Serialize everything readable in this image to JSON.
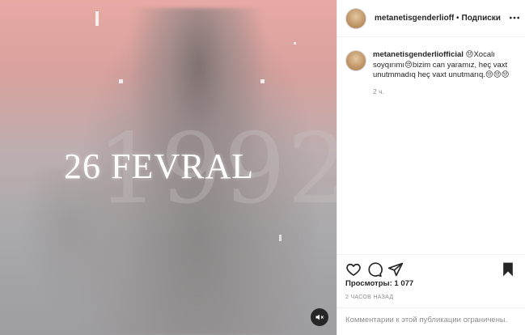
{
  "post": {
    "headline": "26 FEVRAL",
    "ghost_year": "1992"
  },
  "header": {
    "username": "metanetisgenderlioffi",
    "separator": "•",
    "follow_label": "Подписки",
    "more_icon": "more-horizontal-icon"
  },
  "caption": {
    "username": "metanetisgenderliofficial",
    "text": " 😔Xocalı soyqırımı😔bizim can yaramız, heç vaxt unutmmadıq heç vaxt unutmarıq.😔😔😔",
    "time_ago": "2 ч."
  },
  "actions": {
    "like_icon": "heart-icon",
    "comment_icon": "comment-icon",
    "share_icon": "share-icon",
    "save_icon": "bookmark-icon"
  },
  "stats": {
    "views": "Просмотры: 1 077",
    "date": "2 ЧАСОВ НАЗАД"
  },
  "comments": {
    "disabled_notice": "Комментарии к этой публикации ограничены."
  },
  "colors": {
    "text": "#262626",
    "muted": "#8e8e8e",
    "border": "#efefef"
  }
}
